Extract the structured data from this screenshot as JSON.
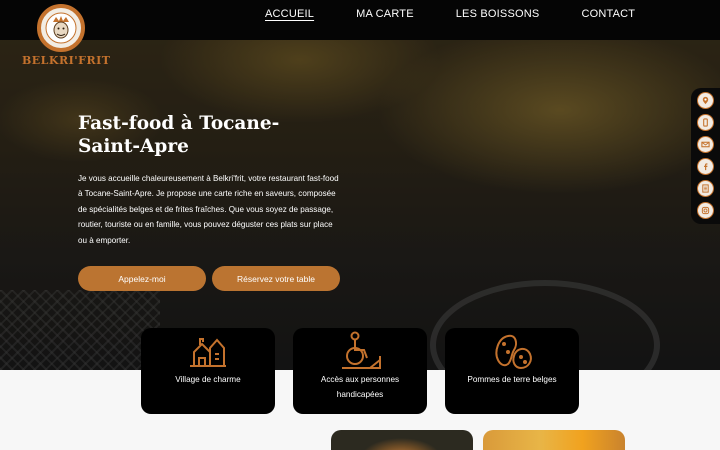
{
  "nav": {
    "items": [
      {
        "label": "ACCUEIL"
      },
      {
        "label": "MA CARTE"
      },
      {
        "label": "LES BOISSONS"
      },
      {
        "label": "CONTACT"
      }
    ]
  },
  "brand": {
    "logo_text": "BELKRI'FRIT"
  },
  "hero": {
    "title": "Fast-food à Tocane-Saint-Apre",
    "description": "Je vous accueille chaleureusement à Belkri'frit, votre restaurant fast-food à Tocane-Saint-Apre. Je propose une carte riche en saveurs, composée de spécialités belges et de frites fraîches. Que vous soyez de passage, routier, touriste ou en famille, vous pouvez déguster ces plats sur place ou à emporter.",
    "call_button": "Appelez-moi",
    "book_button": "Réservez votre table"
  },
  "features": [
    {
      "label": "Village de charme",
      "icon": "village-house-icon"
    },
    {
      "label": "Accès aux personnes handicapées",
      "icon": "wheelchair-ramp-icon"
    },
    {
      "label": "Pommes de terre belges",
      "icon": "potatoes-icon"
    }
  ],
  "social": [
    "map-pin-icon",
    "phone-icon",
    "mail-icon",
    "facebook-icon",
    "menu-card-icon",
    "instagram-icon"
  ],
  "colors": {
    "accent": "#bb7431",
    "topbar": "#050505",
    "card": "#000000"
  }
}
